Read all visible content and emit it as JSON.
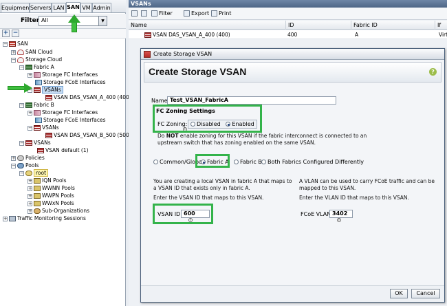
{
  "left_tabs": [
    "Equipment",
    "Servers",
    "LAN",
    "SAN",
    "VM",
    "Admin"
  ],
  "active_tab": "SAN",
  "filter": {
    "label": "Filter:",
    "value": "All"
  },
  "tree": [
    {
      "label": "SAN"
    },
    {
      "label": "SAN Cloud"
    },
    {
      "label": "Storage Cloud"
    },
    {
      "label": "Fabric A"
    },
    {
      "label": "Storage FC Interfaces"
    },
    {
      "label": "Storage FCoE Interfaces"
    },
    {
      "label": "VSANs"
    },
    {
      "label": "VSAN DAS_VSAN_A_400 (400)"
    },
    {
      "label": "Fabric B"
    },
    {
      "label": "Storage FC Interfaces"
    },
    {
      "label": "Storage FCoE Interfaces"
    },
    {
      "label": "VSANs"
    },
    {
      "label": "VSAN DAS_VSAN_B_500 (500)"
    },
    {
      "label": "VSANs"
    },
    {
      "label": "VSAN default (1)"
    },
    {
      "label": "Policies"
    },
    {
      "label": "Pools"
    },
    {
      "label": "root"
    },
    {
      "label": "IQN Pools"
    },
    {
      "label": "WWNN Pools"
    },
    {
      "label": "WWPN Pools"
    },
    {
      "label": "WWxN Pools"
    },
    {
      "label": "Sub-Organizations"
    },
    {
      "label": "Traffic Monitoring Sessions"
    }
  ],
  "right_panel": {
    "title": "VSANs",
    "toolbar": {
      "filter": "Filter",
      "export": "Export",
      "print": "Print"
    },
    "columns": [
      "Name",
      "ID",
      "Fabric ID",
      "If Ty"
    ],
    "rows": [
      {
        "name": "VSAN DAS_VSAN_A_400 (400)",
        "id": "400",
        "fabric": "A",
        "iftype": "Virtua"
      }
    ]
  },
  "dialog": {
    "window_title": "Create Storage VSAN",
    "heading": "Create Storage VSAN",
    "name_label": "Name:",
    "name_value": "Test_VSAN_FabricA",
    "fc_zoning_section": "FC Zoning Settings",
    "fc_zoning_label": "FC Zoning:",
    "fc_zoning_options": [
      "Disabled",
      "Enabled"
    ],
    "fc_zoning_selected": "Enabled",
    "note_prefix": "Do ",
    "note_bold": "NOT",
    "note_rest": " enable zoning for this VSAN if the fabric interconnect is connected to an",
    "note_line2": "upstream switch that has zoning enabled on the same VSAN.",
    "fabric_options": [
      "Common/Global",
      "Fabric A",
      "Fabric B",
      "Both Fabrics Configured Differently"
    ],
    "fabric_selected": "Fabric A",
    "left_info_1": "You are creating a local VSAN in fabric A that maps to",
    "left_info_2": "a VSAN ID that exists only in fabric A.",
    "left_info_3": "Enter the VSAN ID that maps to this VSAN.",
    "right_info_1": "A VLAN can be used to carry FCoE traffic and can be",
    "right_info_2": "mapped to this VSAN.",
    "right_info_3": "Enter the VLAN ID that maps to this VSAN.",
    "vsan_id_label": "VSAN ID:",
    "vsan_id_value": "600",
    "fcoe_vlan_label": "FCoE VLAN:",
    "fcoe_vlan_value": "3402",
    "ok": "OK",
    "cancel": "Cancel"
  },
  "colors": {
    "annotation_green": "#33b34a",
    "title_bar": "#4e6686"
  }
}
